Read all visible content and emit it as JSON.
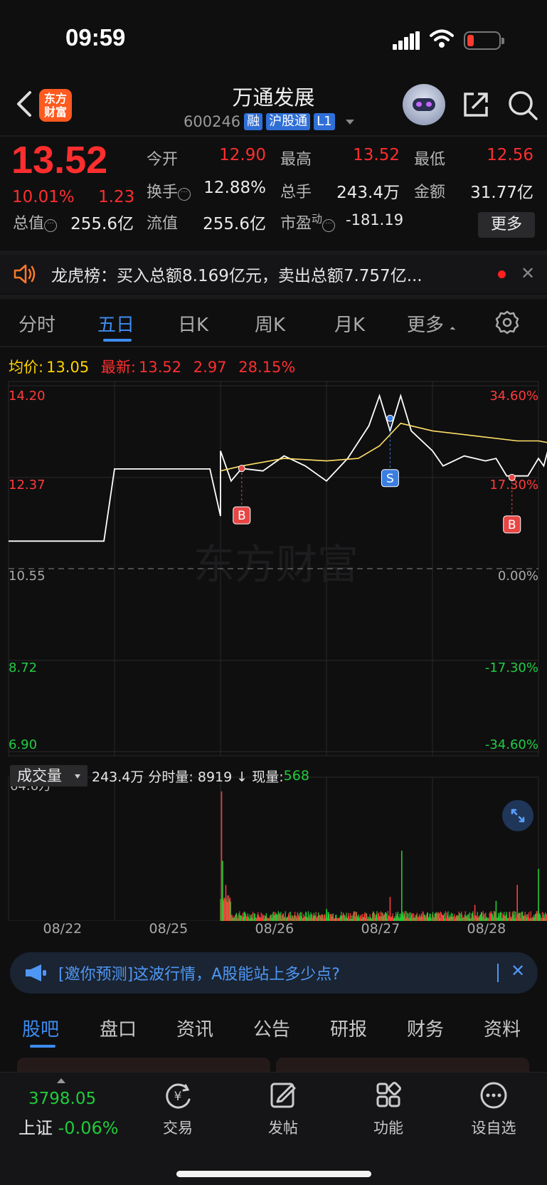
{
  "status_bar": {
    "time": "09:59"
  },
  "header": {
    "logo_text": "东方\n财富",
    "stock_name": "万通发展",
    "code": "600246",
    "tags": [
      "融",
      "沪股通",
      "L1"
    ]
  },
  "quote": {
    "price": "13.52",
    "change_pct": "10.01%",
    "change": "1.23",
    "labels": {
      "open": "今开",
      "high": "最高",
      "low": "最低",
      "turnover": "换手",
      "volume": "总手",
      "amount": "金额",
      "mktcap": "总值",
      "float_cap": "流值",
      "pe": "市盈"
    },
    "open": "12.90",
    "high": "13.52",
    "low": "12.56",
    "turnover": "12.88%",
    "volume": "243.4万",
    "amount": "31.77亿",
    "mktcap": "255.6亿",
    "float_cap": "255.6亿",
    "pe_sup": "动",
    "pe": "-181.19",
    "more_label": "更多"
  },
  "notice": {
    "text": "龙虎榜：买入总额8.169亿元，卖出总额7.757亿..."
  },
  "tabs": [
    "分时",
    "五日",
    "日K",
    "周K",
    "月K",
    "更多"
  ],
  "active_tab": "五日",
  "avg_row": {
    "avg_label": "均价:",
    "avg_value": "13.05",
    "latest_label": "最新:",
    "latest_value": "13.52",
    "chg": "2.97",
    "chg_pct": "28.15%"
  },
  "chart_data": {
    "type": "line",
    "y_left_ticks": [
      "14.20",
      "12.37",
      "10.55",
      "8.72",
      "6.90"
    ],
    "y_right_ticks": [
      "34.60%",
      "17.30%",
      "0.00%",
      "-17.30%",
      "-34.60%"
    ],
    "ylim": [
      6.9,
      14.2
    ],
    "base": 10.55,
    "x_labels": [
      "08/22",
      "08/25",
      "08/26",
      "08/27",
      "08/28"
    ],
    "series": [
      {
        "name": "",
        "color": "#ffffff",
        "values": [
          [
            0.0,
            11.1
          ],
          [
            0.9,
            11.1
          ],
          [
            1.0,
            12.54
          ],
          [
            1.9,
            12.54
          ],
          [
            2.0,
            11.6
          ],
          [
            2.0,
            12.9
          ],
          [
            2.1,
            12.3
          ],
          [
            2.2,
            12.55
          ],
          [
            2.4,
            12.5
          ],
          [
            2.6,
            12.8
          ],
          [
            2.8,
            12.6
          ],
          [
            3.0,
            12.3
          ],
          [
            3.2,
            12.75
          ],
          [
            3.4,
            13.4
          ],
          [
            3.5,
            14.0
          ],
          [
            3.6,
            13.3
          ],
          [
            3.7,
            14.0
          ],
          [
            3.8,
            13.3
          ],
          [
            4.0,
            12.9
          ],
          [
            4.1,
            12.6
          ],
          [
            4.3,
            12.8
          ],
          [
            4.5,
            12.7
          ],
          [
            4.6,
            12.75
          ],
          [
            4.7,
            12.4
          ],
          [
            4.75,
            12.4
          ],
          [
            4.9,
            12.4
          ],
          [
            5.0,
            12.75
          ],
          [
            5.05,
            12.6
          ],
          [
            5.1,
            13.0
          ],
          [
            5.13,
            13.52
          ]
        ]
      },
      {
        "name": "均价",
        "color": "#ffe066",
        "values": [
          [
            2.0,
            12.5
          ],
          [
            2.2,
            12.6
          ],
          [
            2.6,
            12.75
          ],
          [
            3.0,
            12.7
          ],
          [
            3.3,
            12.75
          ],
          [
            3.5,
            13.0
          ],
          [
            3.7,
            13.45
          ],
          [
            4.0,
            13.3
          ],
          [
            4.4,
            13.2
          ],
          [
            4.8,
            13.1
          ],
          [
            5.0,
            13.1
          ],
          [
            5.13,
            13.05
          ]
        ]
      }
    ],
    "markers": [
      {
        "label": "B",
        "x": 2.2,
        "y": 12.55,
        "type": "buy"
      },
      {
        "label": "S",
        "x": 3.6,
        "y": 13.55,
        "type": "sell"
      },
      {
        "label": "B",
        "x": 4.75,
        "y": 12.37,
        "type": "buy"
      }
    ],
    "watermark": "东方财富",
    "volume": {
      "max_label": "64.6万",
      "spikes": [
        [
          2.01,
          64.6
        ],
        [
          2.02,
          30
        ],
        [
          2.05,
          18
        ],
        [
          3.0,
          6
        ],
        [
          3.6,
          12
        ],
        [
          3.71,
          35
        ],
        [
          4.4,
          8
        ],
        [
          4.6,
          10
        ],
        [
          4.8,
          18
        ],
        [
          5.0,
          26
        ],
        [
          5.1,
          20
        ],
        [
          5.13,
          28
        ]
      ]
    }
  },
  "volume_header": {
    "select_label": "成交量",
    "text": "243.4万 分时量: 8919 ↓ 现量: ",
    "current": "568"
  },
  "promo": {
    "text": "[邀你预测]这波行情，A股能站上多少点?"
  },
  "sub_tabs": [
    "股吧",
    "盘口",
    "资讯",
    "公告",
    "研报",
    "财务",
    "资料"
  ],
  "bottom": {
    "index_value": "3798.05",
    "index_name": "上证",
    "index_pct": "-0.06%",
    "nav": [
      "交易",
      "发帖",
      "功能",
      "设自选"
    ]
  }
}
